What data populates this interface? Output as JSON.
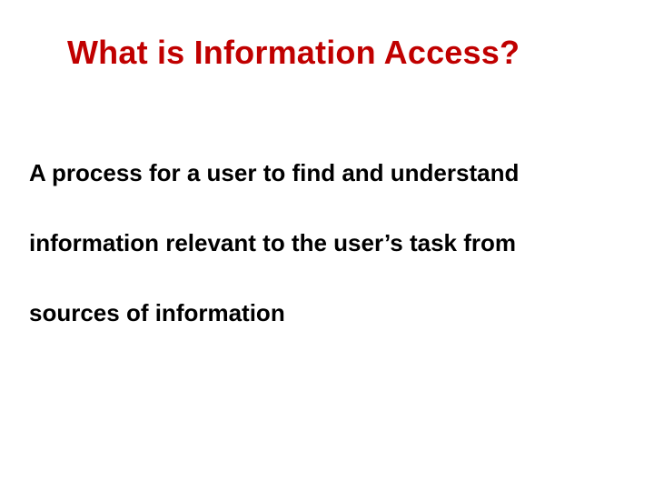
{
  "slide": {
    "title": "What is Information Access?",
    "body": {
      "line1": "A process for a user to find and understand",
      "line2": "information relevant to the user’s task from",
      "line3": "sources of information"
    }
  },
  "colors": {
    "title": "#c00000",
    "body": "#000000",
    "background": "#ffffff"
  }
}
